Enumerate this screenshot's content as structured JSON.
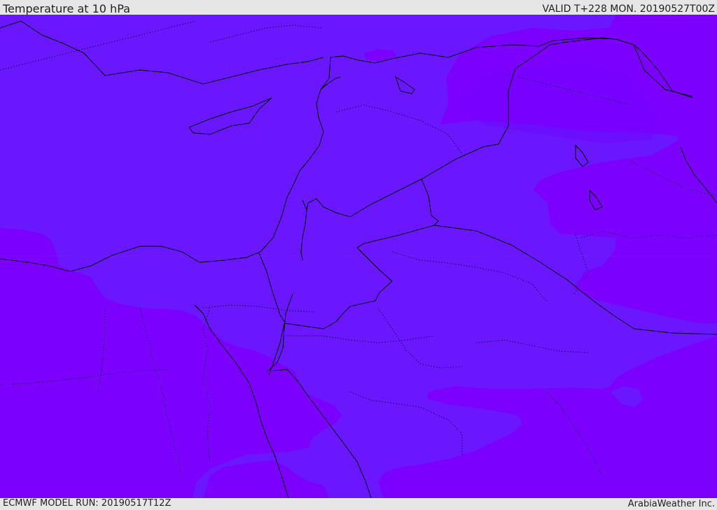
{
  "header": {
    "title": "Temperature at 10 hPa",
    "valid": "VALID T+228 MON. 20190527T00Z"
  },
  "footer": {
    "model_run": "ECMWF MODEL RUN: 20190517T12Z",
    "brand": "ArabiaWeather Inc."
  },
  "map": {
    "variable": "temperature",
    "level": "10 hPa",
    "region": "Middle East",
    "colors": {
      "warmer_band": "#6a16fe",
      "cooler_band": "#7c00fe",
      "coastline": "#000000",
      "borders": "#000000"
    }
  }
}
